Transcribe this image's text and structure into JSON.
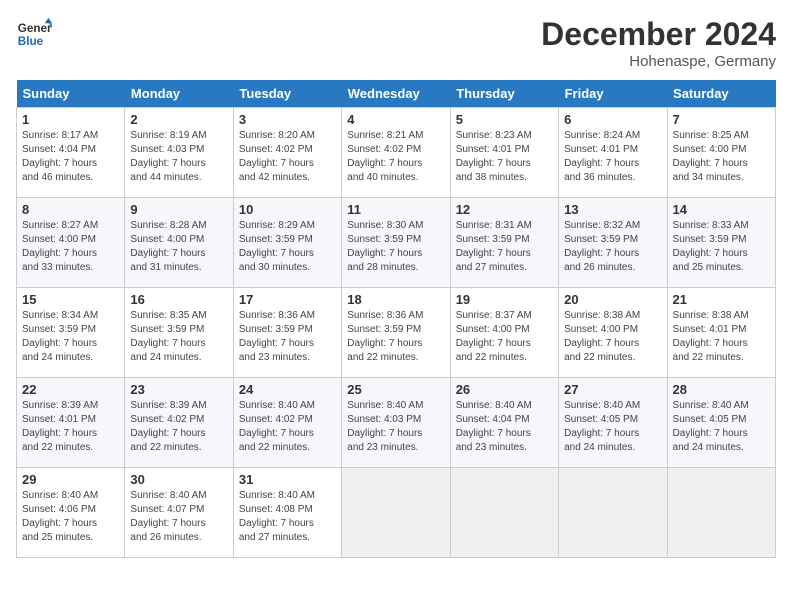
{
  "logo": {
    "line1": "General",
    "line2": "Blue"
  },
  "title": "December 2024",
  "location": "Hohenaspe, Germany",
  "days_of_week": [
    "Sunday",
    "Monday",
    "Tuesday",
    "Wednesday",
    "Thursday",
    "Friday",
    "Saturday"
  ],
  "weeks": [
    [
      {
        "day": "1",
        "info": "Sunrise: 8:17 AM\nSunset: 4:04 PM\nDaylight: 7 hours\nand 46 minutes."
      },
      {
        "day": "2",
        "info": "Sunrise: 8:19 AM\nSunset: 4:03 PM\nDaylight: 7 hours\nand 44 minutes."
      },
      {
        "day": "3",
        "info": "Sunrise: 8:20 AM\nSunset: 4:02 PM\nDaylight: 7 hours\nand 42 minutes."
      },
      {
        "day": "4",
        "info": "Sunrise: 8:21 AM\nSunset: 4:02 PM\nDaylight: 7 hours\nand 40 minutes."
      },
      {
        "day": "5",
        "info": "Sunrise: 8:23 AM\nSunset: 4:01 PM\nDaylight: 7 hours\nand 38 minutes."
      },
      {
        "day": "6",
        "info": "Sunrise: 8:24 AM\nSunset: 4:01 PM\nDaylight: 7 hours\nand 36 minutes."
      },
      {
        "day": "7",
        "info": "Sunrise: 8:25 AM\nSunset: 4:00 PM\nDaylight: 7 hours\nand 34 minutes."
      }
    ],
    [
      {
        "day": "8",
        "info": "Sunrise: 8:27 AM\nSunset: 4:00 PM\nDaylight: 7 hours\nand 33 minutes."
      },
      {
        "day": "9",
        "info": "Sunrise: 8:28 AM\nSunset: 4:00 PM\nDaylight: 7 hours\nand 31 minutes."
      },
      {
        "day": "10",
        "info": "Sunrise: 8:29 AM\nSunset: 3:59 PM\nDaylight: 7 hours\nand 30 minutes."
      },
      {
        "day": "11",
        "info": "Sunrise: 8:30 AM\nSunset: 3:59 PM\nDaylight: 7 hours\nand 28 minutes."
      },
      {
        "day": "12",
        "info": "Sunrise: 8:31 AM\nSunset: 3:59 PM\nDaylight: 7 hours\nand 27 minutes."
      },
      {
        "day": "13",
        "info": "Sunrise: 8:32 AM\nSunset: 3:59 PM\nDaylight: 7 hours\nand 26 minutes."
      },
      {
        "day": "14",
        "info": "Sunrise: 8:33 AM\nSunset: 3:59 PM\nDaylight: 7 hours\nand 25 minutes."
      }
    ],
    [
      {
        "day": "15",
        "info": "Sunrise: 8:34 AM\nSunset: 3:59 PM\nDaylight: 7 hours\nand 24 minutes."
      },
      {
        "day": "16",
        "info": "Sunrise: 8:35 AM\nSunset: 3:59 PM\nDaylight: 7 hours\nand 24 minutes."
      },
      {
        "day": "17",
        "info": "Sunrise: 8:36 AM\nSunset: 3:59 PM\nDaylight: 7 hours\nand 23 minutes."
      },
      {
        "day": "18",
        "info": "Sunrise: 8:36 AM\nSunset: 3:59 PM\nDaylight: 7 hours\nand 22 minutes."
      },
      {
        "day": "19",
        "info": "Sunrise: 8:37 AM\nSunset: 4:00 PM\nDaylight: 7 hours\nand 22 minutes."
      },
      {
        "day": "20",
        "info": "Sunrise: 8:38 AM\nSunset: 4:00 PM\nDaylight: 7 hours\nand 22 minutes."
      },
      {
        "day": "21",
        "info": "Sunrise: 8:38 AM\nSunset: 4:01 PM\nDaylight: 7 hours\nand 22 minutes."
      }
    ],
    [
      {
        "day": "22",
        "info": "Sunrise: 8:39 AM\nSunset: 4:01 PM\nDaylight: 7 hours\nand 22 minutes."
      },
      {
        "day": "23",
        "info": "Sunrise: 8:39 AM\nSunset: 4:02 PM\nDaylight: 7 hours\nand 22 minutes."
      },
      {
        "day": "24",
        "info": "Sunrise: 8:40 AM\nSunset: 4:02 PM\nDaylight: 7 hours\nand 22 minutes."
      },
      {
        "day": "25",
        "info": "Sunrise: 8:40 AM\nSunset: 4:03 PM\nDaylight: 7 hours\nand 23 minutes."
      },
      {
        "day": "26",
        "info": "Sunrise: 8:40 AM\nSunset: 4:04 PM\nDaylight: 7 hours\nand 23 minutes."
      },
      {
        "day": "27",
        "info": "Sunrise: 8:40 AM\nSunset: 4:05 PM\nDaylight: 7 hours\nand 24 minutes."
      },
      {
        "day": "28",
        "info": "Sunrise: 8:40 AM\nSunset: 4:05 PM\nDaylight: 7 hours\nand 24 minutes."
      }
    ],
    [
      {
        "day": "29",
        "info": "Sunrise: 8:40 AM\nSunset: 4:06 PM\nDaylight: 7 hours\nand 25 minutes."
      },
      {
        "day": "30",
        "info": "Sunrise: 8:40 AM\nSunset: 4:07 PM\nDaylight: 7 hours\nand 26 minutes."
      },
      {
        "day": "31",
        "info": "Sunrise: 8:40 AM\nSunset: 4:08 PM\nDaylight: 7 hours\nand 27 minutes."
      },
      null,
      null,
      null,
      null
    ]
  ]
}
